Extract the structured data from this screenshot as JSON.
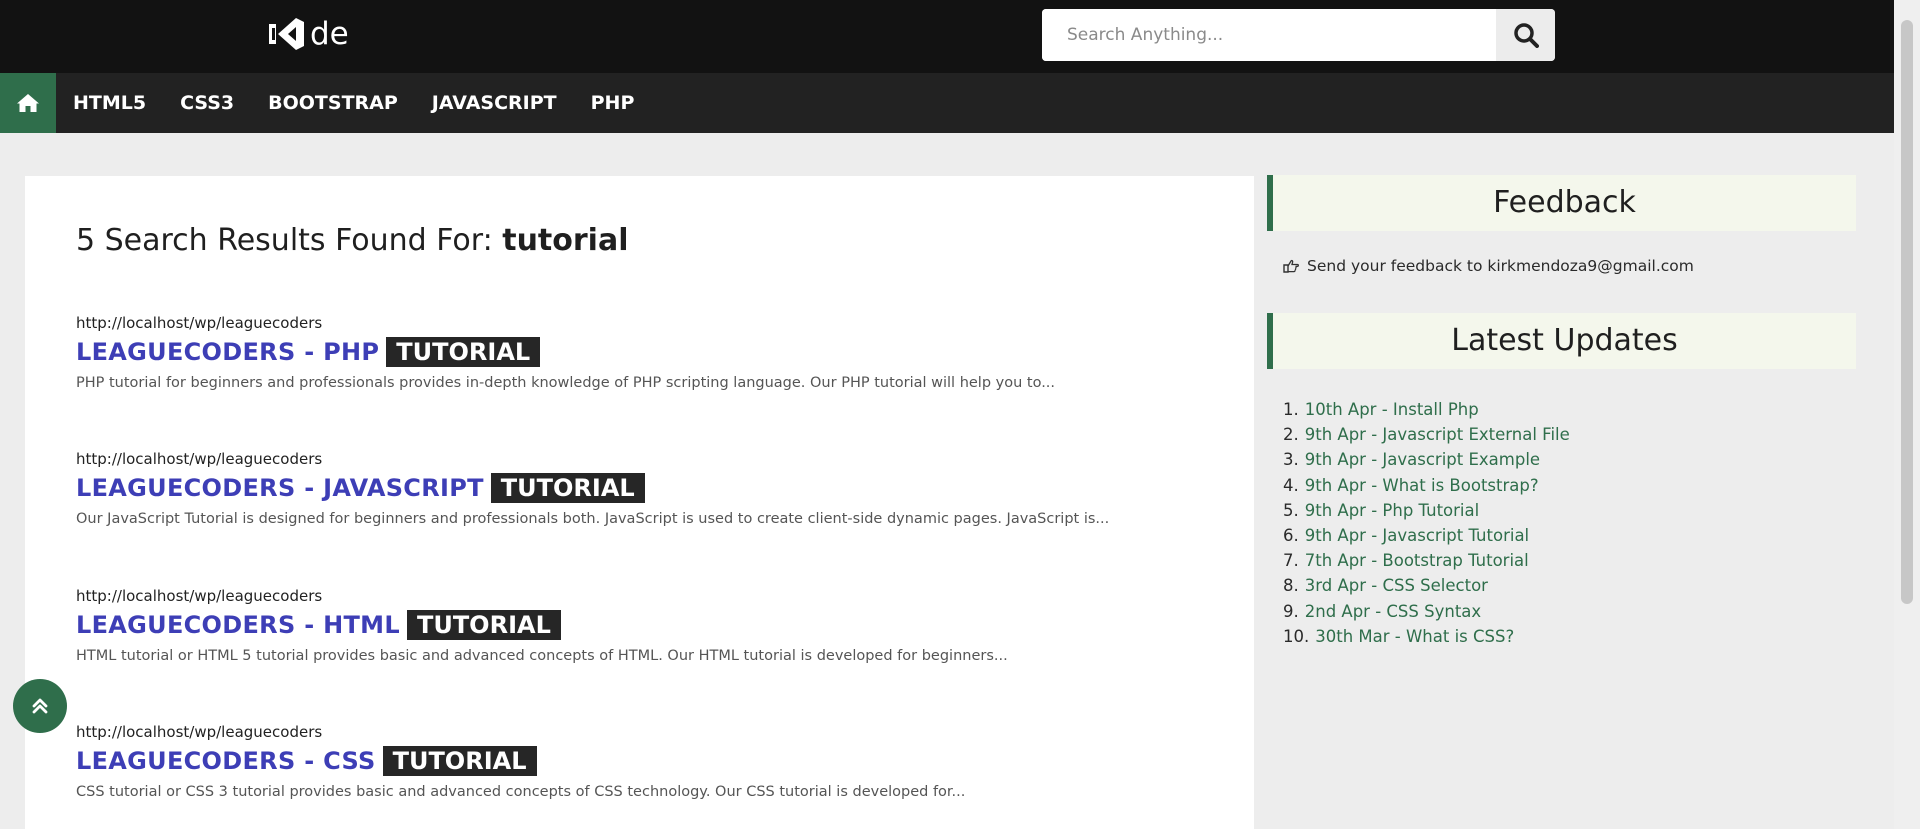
{
  "brand": {
    "logo_text": "de"
  },
  "search": {
    "placeholder": "Search Anything...",
    "button_icon": "search-icon"
  },
  "nav": {
    "home_icon": "home-icon",
    "items": [
      "HTML5",
      "CSS3",
      "BOOTSTRAP",
      "JAVASCRIPT",
      "PHP"
    ]
  },
  "results": {
    "heading_prefix": "5 Search Results Found For: ",
    "query": "tutorial",
    "items": [
      {
        "url": "http://localhost/wp/leaguecoders",
        "title": "LEAGUECODERS - PHP",
        "tag": "TUTORIAL",
        "description": "PHP tutorial for beginners and professionals provides in-depth knowledge of PHP scripting language. Our PHP tutorial will help you to..."
      },
      {
        "url": "http://localhost/wp/leaguecoders",
        "title": "LEAGUECODERS - JAVASCRIPT",
        "tag": "TUTORIAL",
        "description": "Our JavaScript Tutorial is designed for beginners and professionals both. JavaScript is used to create client-side dynamic pages. JavaScript is..."
      },
      {
        "url": "http://localhost/wp/leaguecoders",
        "title": "LEAGUECODERS - HTML",
        "tag": "TUTORIAL",
        "description": "HTML tutorial or HTML 5 tutorial provides basic and advanced concepts of HTML. Our HTML tutorial is developed for beginners..."
      },
      {
        "url": "http://localhost/wp/leaguecoders",
        "title": "LEAGUECODERS - CSS",
        "tag": "TUTORIAL",
        "description": "CSS tutorial or CSS 3 tutorial provides basic and advanced concepts of CSS technology. Our CSS tutorial is developed for..."
      }
    ]
  },
  "sidebar": {
    "feedback": {
      "title": "Feedback",
      "text": "Send your feedback to kirkmendoza9@gmail.com",
      "icon": "hand-point-right-icon"
    },
    "latest": {
      "title": "Latest Updates",
      "items": [
        {
          "num": "1.",
          "label": "10th Apr - Install Php"
        },
        {
          "num": "2.",
          "label": "9th Apr - Javascript External File"
        },
        {
          "num": "3.",
          "label": "9th Apr - Javascript Example"
        },
        {
          "num": "4.",
          "label": "9th Apr - What is Bootstrap?"
        },
        {
          "num": "5.",
          "label": "9th Apr - Php Tutorial"
        },
        {
          "num": "6.",
          "label": "9th Apr - Javascript Tutorial"
        },
        {
          "num": "7.",
          "label": "7th Apr - Bootstrap Tutorial"
        },
        {
          "num": "8.",
          "label": "3rd Apr - CSS Selector"
        },
        {
          "num": "9.",
          "label": "2nd Apr - CSS Syntax"
        },
        {
          "num": "10.",
          "label": "30th Mar - What is CSS?"
        }
      ]
    }
  },
  "back_to_top": {
    "icon": "double-chevron-up-icon"
  },
  "colors": {
    "accent_green": "#2f6e4b",
    "link_blue": "#3d3eb6",
    "topbar": "#121212",
    "navbar": "#222222"
  }
}
